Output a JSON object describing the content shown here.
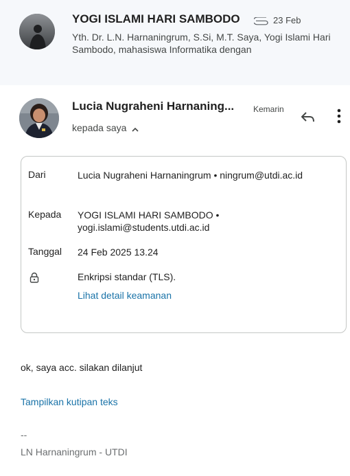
{
  "previous_message": {
    "sender": "YOGI ISLAMI HARI SAMBODO",
    "date": "23 Feb",
    "snippet": "Yth. Dr. L.N. Harnaningrum, S.Si, M.T. Saya, Yogi Islami Hari Sambodo, mahasiswa Informatika dengan",
    "attachment_icon": "paperclip-icon"
  },
  "message": {
    "sender": "Lucia Nugraheni Harnaning...",
    "time": "Kemarin",
    "recipient_summary": "kepada saya",
    "details": {
      "from_label": "Dari",
      "from_value": "Lucia Nugraheni Harnaningrum • ningrum@utdi.ac.id",
      "to_label": "Kepada",
      "to_value": "YOGI ISLAMI HARI SAMBODO • yogi.islami@students.utdi.ac.id",
      "date_label": "Tanggal",
      "date_value": "24 Feb 2025 13.24",
      "security_icon": "lock-icon",
      "security_value": "Enkripsi standar (TLS).",
      "security_link": "Lihat detail keamanan"
    },
    "body": "ok, saya acc. silakan dilanjut",
    "show_quoted": "Tampilkan kutipan teks",
    "signature_separator": "--",
    "signature": "LN Harnaningrum - UTDI"
  },
  "colors": {
    "link": "#1a73a8",
    "collapsed_bg": "#f6f8fb",
    "border": "#c4c7c5"
  }
}
